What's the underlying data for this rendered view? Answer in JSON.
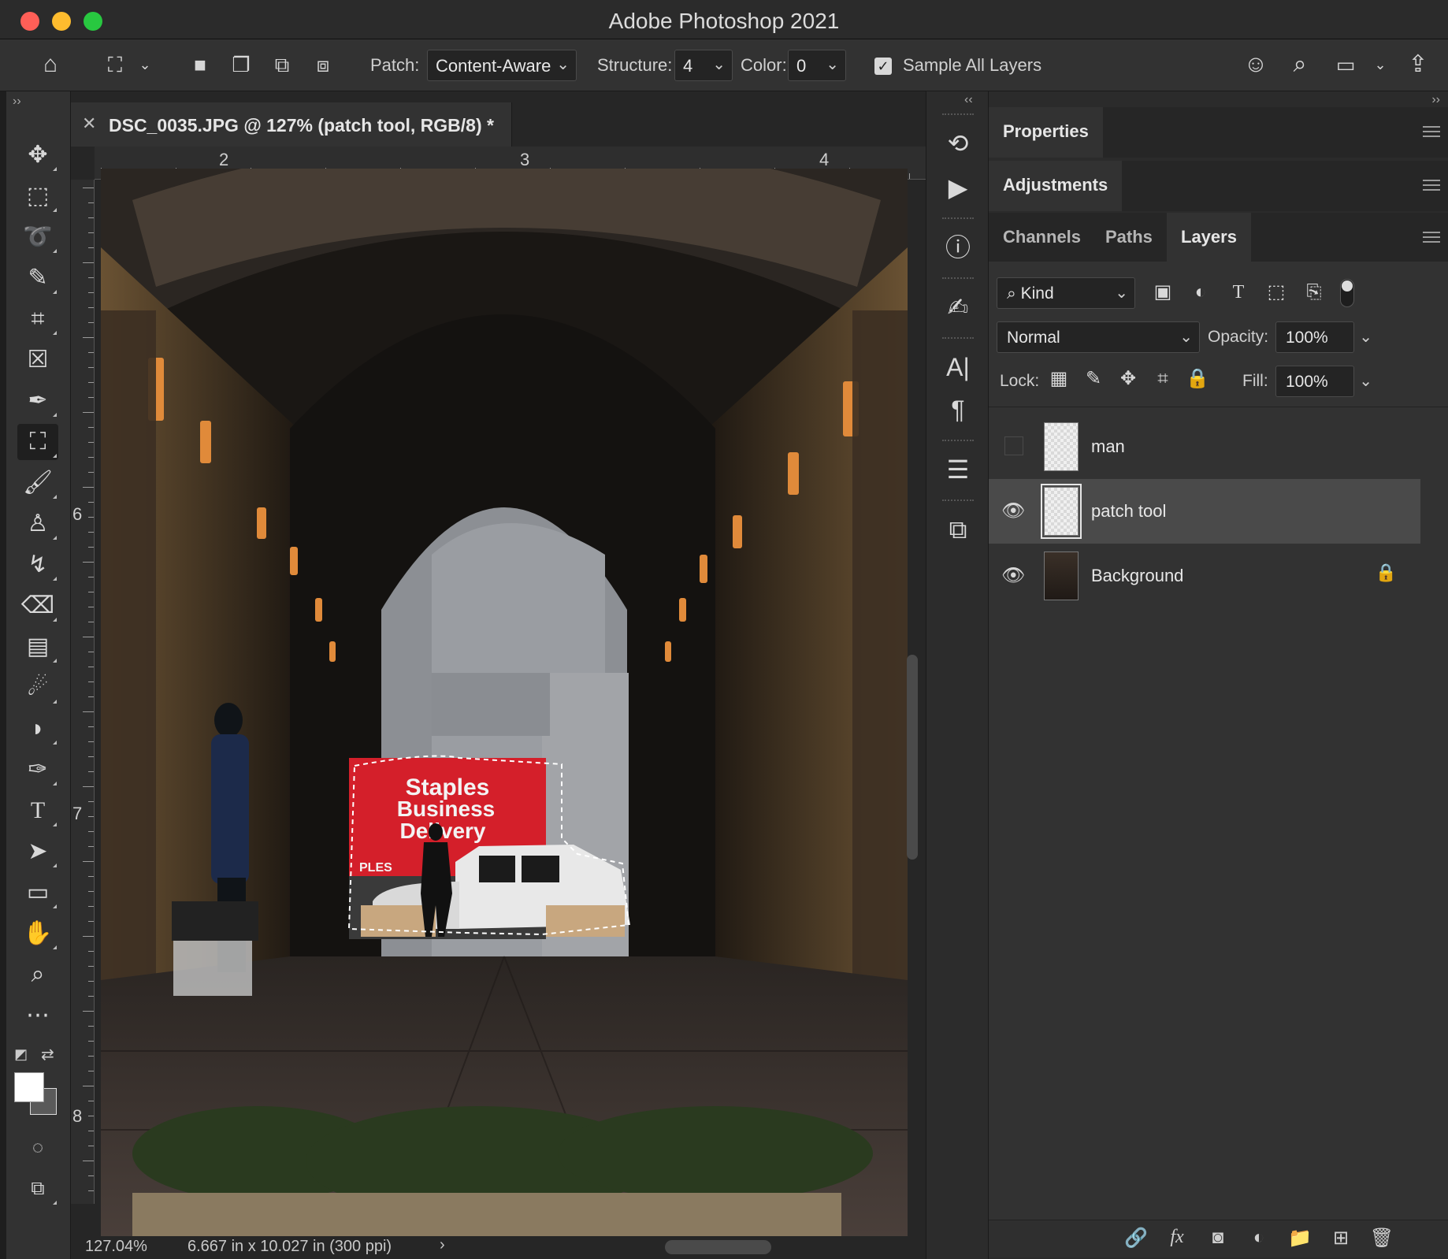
{
  "window": {
    "title": "Adobe Photoshop 2021"
  },
  "options_bar": {
    "patch_label": "Patch:",
    "patch_value": "Content-Aware",
    "structure_label": "Structure:",
    "structure_value": "4",
    "color_label": "Color:",
    "color_value": "0",
    "sample_all_layers_label": "Sample All Layers",
    "sample_all_layers_checked": true
  },
  "document": {
    "tab_title": "DSC_0035.JPG @ 127% (patch tool, RGB/8) *",
    "ruler_h_labels": [
      "2",
      "3",
      "4"
    ],
    "ruler_v_labels": [
      "6",
      "7",
      "8"
    ],
    "zoom": "127.04%",
    "doc_info": "6.667 in x 10.027 in (300 ppi)",
    "photo_sign_lines": [
      "Staples",
      "Business",
      "Delivery"
    ],
    "photo_sign_side": "PLES"
  },
  "panels": {
    "properties_label": "Properties",
    "adjustments_label": "Adjustments",
    "tabs": [
      "Channels",
      "Paths",
      "Layers"
    ],
    "active_tab": "Layers"
  },
  "layers_panel": {
    "filter_kind": "Kind",
    "blend_mode": "Normal",
    "opacity_label": "Opacity:",
    "opacity_value": "100%",
    "lock_label": "Lock:",
    "fill_label": "Fill:",
    "fill_value": "100%",
    "layers": [
      {
        "name": "man",
        "visible": false,
        "selected": false,
        "locked": false
      },
      {
        "name": "patch tool",
        "visible": true,
        "selected": true,
        "locked": false
      },
      {
        "name": "Background",
        "visible": true,
        "selected": false,
        "locked": true
      }
    ]
  },
  "colors": {
    "accent_traffic_red": "#ff5f57",
    "accent_traffic_yellow": "#febc2e",
    "accent_traffic_green": "#28c840",
    "truck_red": "#d41f2a"
  }
}
